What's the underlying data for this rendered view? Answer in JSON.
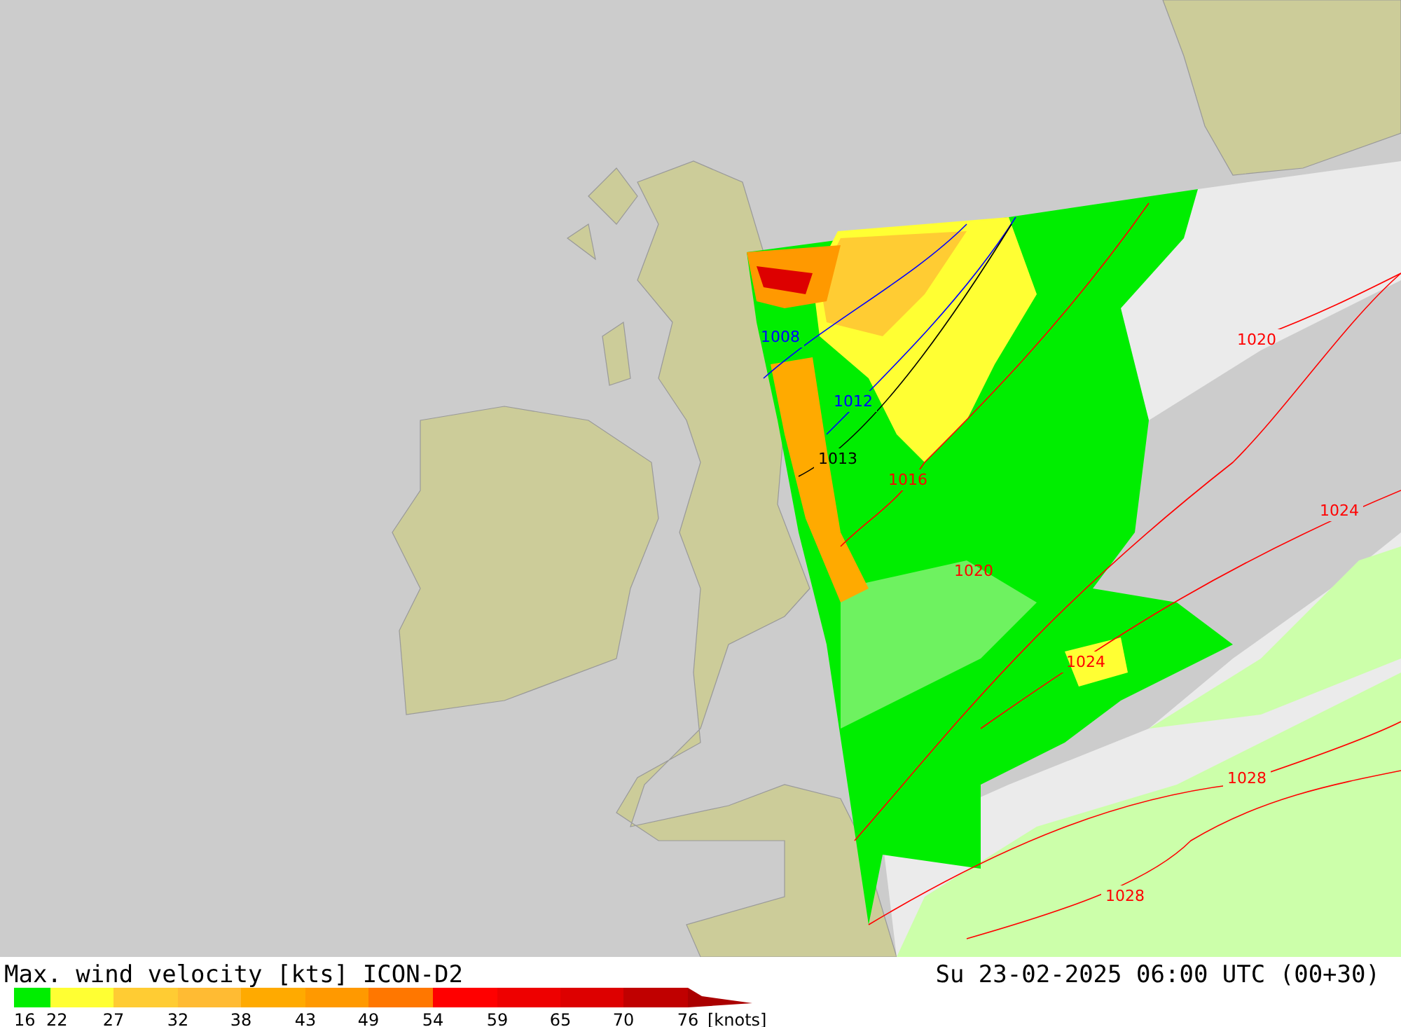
{
  "map": {
    "isobars": [
      {
        "label": "1008",
        "color": "#0000ff"
      },
      {
        "label": "1012",
        "color": "#0000ff"
      },
      {
        "label": "1013",
        "color": "#000000"
      },
      {
        "label": "1016",
        "color": "#ff0000"
      },
      {
        "label": "1020",
        "color": "#ff0000"
      },
      {
        "label": "1020",
        "color": "#ff0000"
      },
      {
        "label": "1024",
        "color": "#ff0000"
      },
      {
        "label": "1024",
        "color": "#ff0000"
      },
      {
        "label": "1028",
        "color": "#ff0000"
      },
      {
        "label": "1028",
        "color": "#ff0000"
      }
    ]
  },
  "legend": {
    "title": "Max. wind velocity [kts] ICON-D2",
    "timestamp": "Su 23-02-2025 06:00 UTC (00+30)",
    "segments": [
      {
        "color": "#00ee00"
      },
      {
        "color": "#ffff33"
      },
      {
        "color": "#ffcc33"
      },
      {
        "color": "#ffbb33"
      },
      {
        "color": "#ffaa00"
      },
      {
        "color": "#ff9900"
      },
      {
        "color": "#ff7700"
      },
      {
        "color": "#ff0000"
      },
      {
        "color": "#ee0000"
      },
      {
        "color": "#dd0000"
      },
      {
        "color": "#c00000"
      },
      {
        "color": "#aa0000"
      }
    ],
    "ticks": [
      "16",
      "22",
      "27",
      "32",
      "38",
      "43",
      "49",
      "54",
      "59",
      "65",
      "70",
      "76"
    ],
    "unit": "[knots]"
  }
}
